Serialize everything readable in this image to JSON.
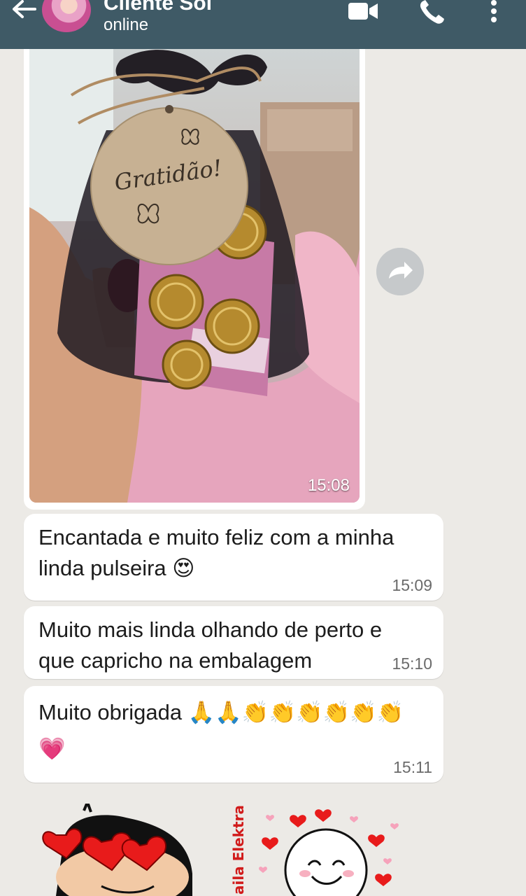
{
  "header": {
    "contact_name": "Cliente Sol",
    "status": "online",
    "icons": [
      "back-arrow-icon",
      "video-call-icon",
      "voice-call-icon",
      "more-options-icon"
    ]
  },
  "messages": [
    {
      "type": "image",
      "time": "15:08",
      "image_text": "Gratidão!"
    },
    {
      "type": "text",
      "text": "Encantada e muito feliz com a minha linda pulseira 😍",
      "time": "15:09"
    },
    {
      "type": "text",
      "text": "Muito mais linda olhando de perto e que capricho na embalagem",
      "time": "15:10"
    },
    {
      "type": "text",
      "text": "Muito obrigada 🙏🙏👏👏👏👏👏👏💗",
      "time": "15:11"
    }
  ],
  "stickers": [
    {
      "name": "heart-eyes-cartoon-sticker"
    },
    {
      "name": "smiley-hearts-sticker",
      "caption": "aila Elektra"
    }
  ],
  "colors": {
    "header": "#3f5a66",
    "background": "#eceae6",
    "bubble": "#ffffff",
    "time_text": "#6b6b6b"
  }
}
